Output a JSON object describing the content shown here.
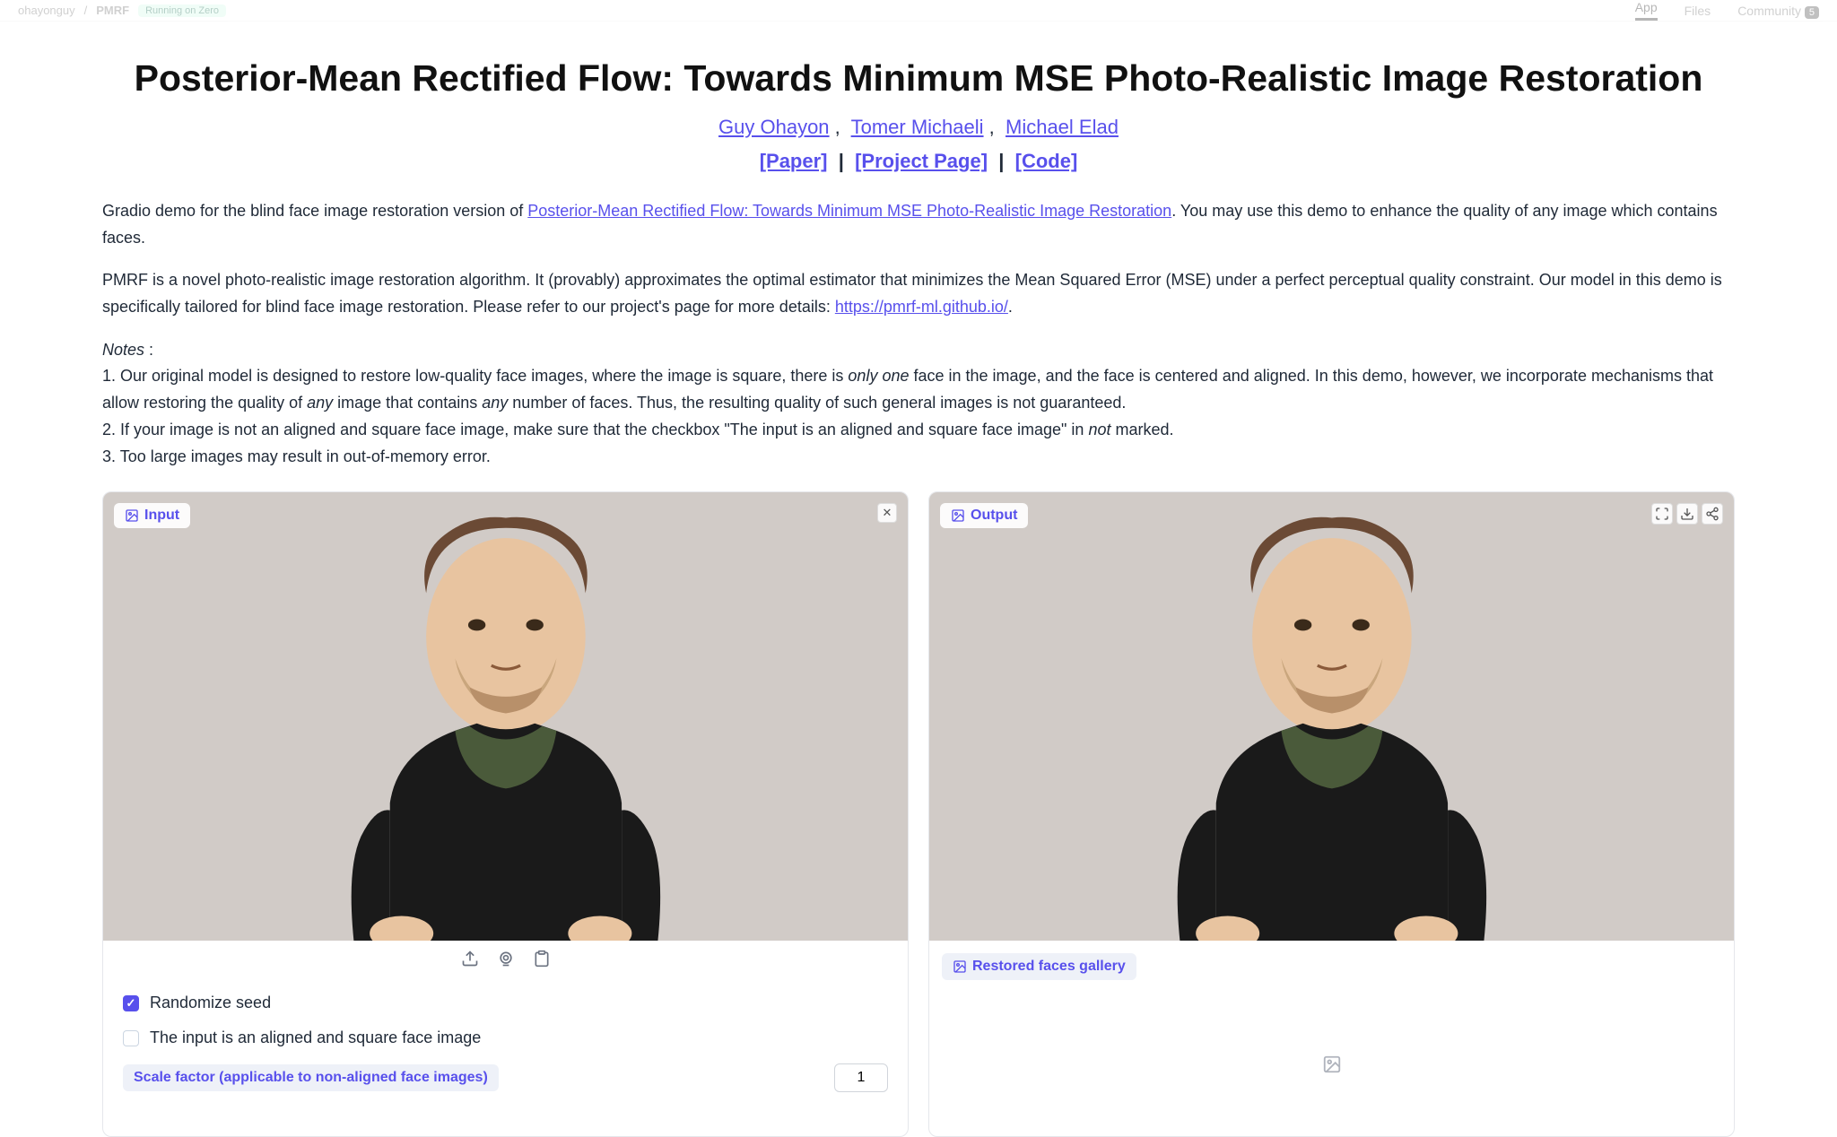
{
  "topbar": {
    "breadcrumb_user": "ohayonguy",
    "breadcrumb_repo": "PMRF",
    "running_label": "Running on Zero",
    "tab_app": "App",
    "tab_files": "Files",
    "tab_community": "Community",
    "community_count": "5"
  },
  "title": "Posterior-Mean Rectified Flow: Towards Minimum MSE Photo-Realistic Image Restoration",
  "authors": [
    "Guy Ohayon",
    "Tomer Michaeli",
    "Michael Elad"
  ],
  "links": {
    "paper": "[Paper]",
    "project": "[Project Page]",
    "code": "[Code]"
  },
  "desc1_prefix": "Gradio demo for the blind face image restoration version of ",
  "desc1_link": "Posterior-Mean Rectified Flow: Towards Minimum MSE Photo-Realistic Image Restoration",
  "desc1_suffix": ". You may use this demo to enhance the quality of any image which contains faces.",
  "desc2_a": "PMRF is a novel photo-realistic image restoration algorithm. It (provably) approximates the optimal estimator that minimizes the Mean Squared Error (MSE) under a perfect perceptual quality constraint. Our model in this demo is specifically tailored for blind face image restoration. Please refer to our project's page for more details: ",
  "desc2_link": "https://pmrf-ml.github.io/",
  "notes_label": "Notes",
  "note1_a": "1. Our original model is designed to restore low-quality face images, where the image is square, there is ",
  "note1_em1": "only one",
  "note1_b": " face in the image, and the face is centered and aligned. In this demo, however, we incorporate mechanisms that allow restoring the quality of ",
  "note1_em2": "any",
  "note1_c": " image that contains ",
  "note1_em3": "any",
  "note1_d": " number of faces. Thus, the resulting quality of such general images is not guaranteed.",
  "note2_a": "2. If your image is not an aligned and square face image, make sure that the checkbox \"The input is an aligned and square face image\" in ",
  "note2_em": "not",
  "note2_b": " marked.",
  "note3": "3. Too large images may result in out-of-memory error.",
  "input_label": "Input",
  "output_label": "Output",
  "randomize_label": "Randomize seed",
  "aligned_label": "The input is an aligned and square face image",
  "scale_label": "Scale factor (applicable to non-aligned face images)",
  "scale_value": "1",
  "gallery_label": "Restored faces gallery"
}
